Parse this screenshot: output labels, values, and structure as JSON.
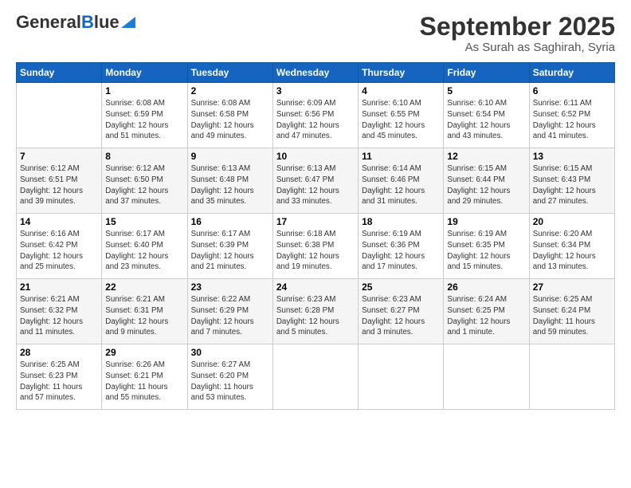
{
  "header": {
    "logo_line1": "General",
    "logo_line2": "Blue",
    "month_title": "September 2025",
    "location": "As Surah as Saghirah, Syria"
  },
  "days_of_week": [
    "Sunday",
    "Monday",
    "Tuesday",
    "Wednesday",
    "Thursday",
    "Friday",
    "Saturday"
  ],
  "weeks": [
    [
      {
        "day": "",
        "info": ""
      },
      {
        "day": "1",
        "info": "Sunrise: 6:08 AM\nSunset: 6:59 PM\nDaylight: 12 hours\nand 51 minutes."
      },
      {
        "day": "2",
        "info": "Sunrise: 6:08 AM\nSunset: 6:58 PM\nDaylight: 12 hours\nand 49 minutes."
      },
      {
        "day": "3",
        "info": "Sunrise: 6:09 AM\nSunset: 6:56 PM\nDaylight: 12 hours\nand 47 minutes."
      },
      {
        "day": "4",
        "info": "Sunrise: 6:10 AM\nSunset: 6:55 PM\nDaylight: 12 hours\nand 45 minutes."
      },
      {
        "day": "5",
        "info": "Sunrise: 6:10 AM\nSunset: 6:54 PM\nDaylight: 12 hours\nand 43 minutes."
      },
      {
        "day": "6",
        "info": "Sunrise: 6:11 AM\nSunset: 6:52 PM\nDaylight: 12 hours\nand 41 minutes."
      }
    ],
    [
      {
        "day": "7",
        "info": "Sunrise: 6:12 AM\nSunset: 6:51 PM\nDaylight: 12 hours\nand 39 minutes."
      },
      {
        "day": "8",
        "info": "Sunrise: 6:12 AM\nSunset: 6:50 PM\nDaylight: 12 hours\nand 37 minutes."
      },
      {
        "day": "9",
        "info": "Sunrise: 6:13 AM\nSunset: 6:48 PM\nDaylight: 12 hours\nand 35 minutes."
      },
      {
        "day": "10",
        "info": "Sunrise: 6:13 AM\nSunset: 6:47 PM\nDaylight: 12 hours\nand 33 minutes."
      },
      {
        "day": "11",
        "info": "Sunrise: 6:14 AM\nSunset: 6:46 PM\nDaylight: 12 hours\nand 31 minutes."
      },
      {
        "day": "12",
        "info": "Sunrise: 6:15 AM\nSunset: 6:44 PM\nDaylight: 12 hours\nand 29 minutes."
      },
      {
        "day": "13",
        "info": "Sunrise: 6:15 AM\nSunset: 6:43 PM\nDaylight: 12 hours\nand 27 minutes."
      }
    ],
    [
      {
        "day": "14",
        "info": "Sunrise: 6:16 AM\nSunset: 6:42 PM\nDaylight: 12 hours\nand 25 minutes."
      },
      {
        "day": "15",
        "info": "Sunrise: 6:17 AM\nSunset: 6:40 PM\nDaylight: 12 hours\nand 23 minutes."
      },
      {
        "day": "16",
        "info": "Sunrise: 6:17 AM\nSunset: 6:39 PM\nDaylight: 12 hours\nand 21 minutes."
      },
      {
        "day": "17",
        "info": "Sunrise: 6:18 AM\nSunset: 6:38 PM\nDaylight: 12 hours\nand 19 minutes."
      },
      {
        "day": "18",
        "info": "Sunrise: 6:19 AM\nSunset: 6:36 PM\nDaylight: 12 hours\nand 17 minutes."
      },
      {
        "day": "19",
        "info": "Sunrise: 6:19 AM\nSunset: 6:35 PM\nDaylight: 12 hours\nand 15 minutes."
      },
      {
        "day": "20",
        "info": "Sunrise: 6:20 AM\nSunset: 6:34 PM\nDaylight: 12 hours\nand 13 minutes."
      }
    ],
    [
      {
        "day": "21",
        "info": "Sunrise: 6:21 AM\nSunset: 6:32 PM\nDaylight: 12 hours\nand 11 minutes."
      },
      {
        "day": "22",
        "info": "Sunrise: 6:21 AM\nSunset: 6:31 PM\nDaylight: 12 hours\nand 9 minutes."
      },
      {
        "day": "23",
        "info": "Sunrise: 6:22 AM\nSunset: 6:29 PM\nDaylight: 12 hours\nand 7 minutes."
      },
      {
        "day": "24",
        "info": "Sunrise: 6:23 AM\nSunset: 6:28 PM\nDaylight: 12 hours\nand 5 minutes."
      },
      {
        "day": "25",
        "info": "Sunrise: 6:23 AM\nSunset: 6:27 PM\nDaylight: 12 hours\nand 3 minutes."
      },
      {
        "day": "26",
        "info": "Sunrise: 6:24 AM\nSunset: 6:25 PM\nDaylight: 12 hours\nand 1 minute."
      },
      {
        "day": "27",
        "info": "Sunrise: 6:25 AM\nSunset: 6:24 PM\nDaylight: 11 hours\nand 59 minutes."
      }
    ],
    [
      {
        "day": "28",
        "info": "Sunrise: 6:25 AM\nSunset: 6:23 PM\nDaylight: 11 hours\nand 57 minutes."
      },
      {
        "day": "29",
        "info": "Sunrise: 6:26 AM\nSunset: 6:21 PM\nDaylight: 11 hours\nand 55 minutes."
      },
      {
        "day": "30",
        "info": "Sunrise: 6:27 AM\nSunset: 6:20 PM\nDaylight: 11 hours\nand 53 minutes."
      },
      {
        "day": "",
        "info": ""
      },
      {
        "day": "",
        "info": ""
      },
      {
        "day": "",
        "info": ""
      },
      {
        "day": "",
        "info": ""
      }
    ]
  ]
}
